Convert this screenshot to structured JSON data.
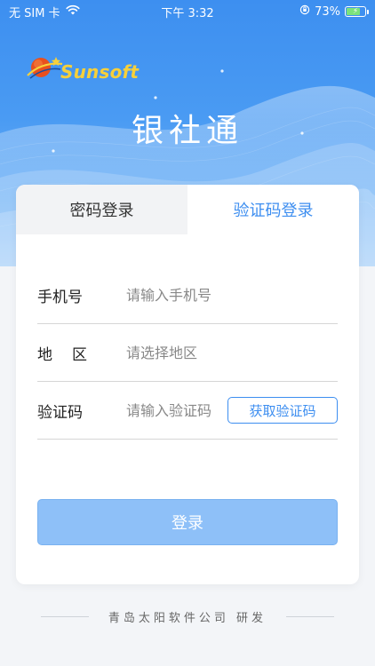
{
  "status_bar": {
    "carrier": "无 SIM 卡",
    "time": "下午 3:32",
    "battery": "73%",
    "battery_level": 0.73
  },
  "brand": {
    "logo_text": "Sunsoft",
    "app_title": "银社通"
  },
  "tabs": [
    {
      "label": "密码登录",
      "active": false
    },
    {
      "label": "验证码登录",
      "active": true
    }
  ],
  "form": {
    "phone": {
      "label": "手机号",
      "placeholder": "请输入手机号",
      "value": ""
    },
    "region": {
      "label": "地区",
      "placeholder": "请选择地区",
      "value": ""
    },
    "code": {
      "label": "验证码",
      "placeholder": "请输入验证码",
      "value": "",
      "button_label": "获取验证码"
    }
  },
  "login_button": {
    "label": "登录"
  },
  "footer": {
    "text": "青岛太阳软件公司 研发"
  },
  "colors": {
    "primary": "#3d8ef0",
    "login_disabled": "#8ec0f8",
    "logo_yellow": "#f7d03a"
  },
  "icons": [
    "wifi-icon",
    "orientation-lock-icon",
    "battery-icon",
    "sunsoft-logo-icon"
  ]
}
